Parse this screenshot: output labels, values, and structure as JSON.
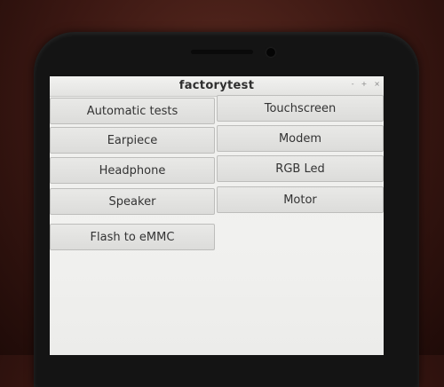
{
  "window": {
    "title": "factorytest",
    "controls": {
      "minimize": "-",
      "maximize": "+",
      "close": "×"
    }
  },
  "buttons": {
    "automatic_tests": "Automatic tests",
    "touchscreen": "Touchscreen",
    "earpiece": "Earpiece",
    "modem": "Modem",
    "headphone": "Headphone",
    "rgb_led": "RGB Led",
    "speaker": "Speaker",
    "motor": "Motor",
    "flash_to_emmc": "Flash to eMMC"
  },
  "colors": {
    "button_bg": "#e3e3e1",
    "window_bg": "#f0f0ee",
    "bezel": "#141414"
  }
}
